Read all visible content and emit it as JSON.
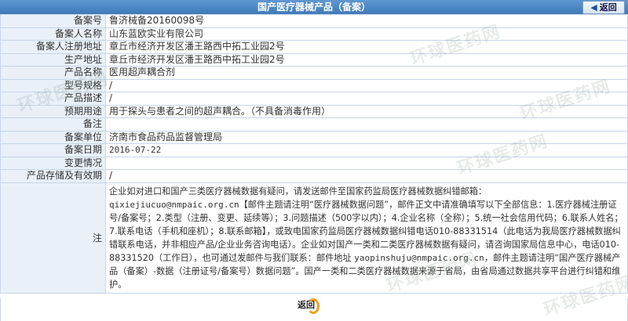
{
  "window": {
    "title": "国产医疗器械产品（备案）",
    "back_top": "返回"
  },
  "fields": [
    {
      "label": "备案号",
      "value": "鲁济械备20160098号"
    },
    {
      "label": "备案人名称",
      "value": "山东蓝欧实业有限公司"
    },
    {
      "label": "备案人注册地址",
      "value": "章丘市经济开发区潘王路西中拓工业园2号"
    },
    {
      "label": "生产地址",
      "value": "章丘市经济开发区潘王路西中拓工业园2号"
    },
    {
      "label": "产品名称",
      "value": "医用超声耦合剂"
    },
    {
      "label": "型号规格",
      "value": "/"
    },
    {
      "label": "产品描述",
      "value": "/"
    },
    {
      "label": "预期用途",
      "value": "用于探头与患者之间的超声耦合。（不具备消毒作用）"
    },
    {
      "label": "备注",
      "value": ""
    },
    {
      "label": "备案单位",
      "value": "济南市食品药品监督管理局"
    },
    {
      "label": "备案日期",
      "value": "2016-07-22"
    },
    {
      "label": "变更情况",
      "value": ""
    },
    {
      "label": "产品存储及有效期",
      "value": "/"
    }
  ],
  "note": {
    "label": "注",
    "p1": "企业如对进口和国产三类医疗器械数据有疑问，请发送邮件至国家药监局医疗器械数据纠错邮箱：",
    "email1": "qixiejiucuo@nmpaic.org.cn",
    "p2": "【邮件主题请注明“医疗器械数据问题”，邮件正文中请准确填写以下全部信息：1.医疗器械注册证号/备案号；2.类型（注册、变更、延续等）；3.问题描述（500字以内）；4.企业名称（全称）；5.统一社会信用代码；6.联系人姓名；7.联系电话（手机和座机）；8.联系邮箱】，或致电国家药监局医疗器械数据纠错电话010-88331514（此电话为我局医疗器械数据纠错联系电话，并非相应产品/企业业务咨询电话）。企业如对国产一类和二类医疗器械数据有疑问，请咨询国家局信息中心，电话010-88331520（工作日），也可通过发邮件与我们联系：邮件地址",
    "email2": "yaopinshuju@nmpaic.org.cn",
    "p3": "，邮件主题请注明“国产医疗器械产品（备案）-数据（注册证号/备案号）数据问题”。国产一类和二类医疗器械数据来源于省局，由省局通过数据共享平台进行纠错和维护。"
  },
  "footer": {
    "back_label": "返回"
  },
  "watermark": "环球医药网"
}
